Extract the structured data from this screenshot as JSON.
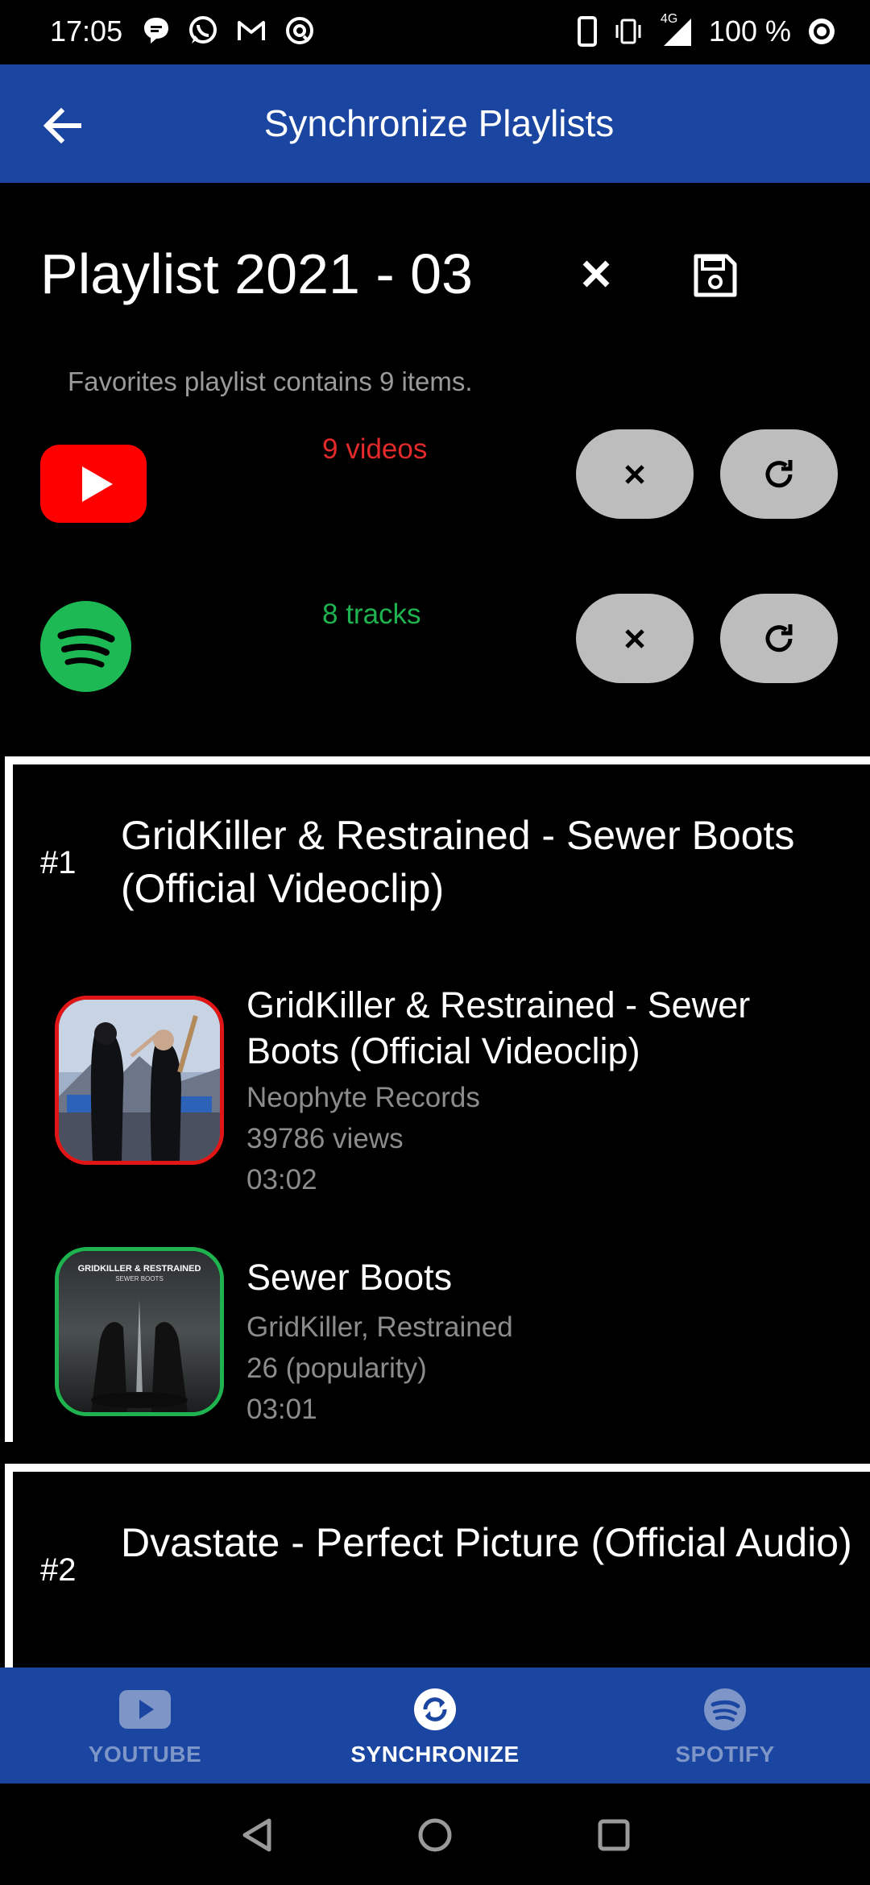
{
  "status_bar": {
    "time": "17:05",
    "network": "4G",
    "battery": "100 %",
    "left_icons": [
      "message-icon",
      "whatsapp-icon",
      "gmail-icon",
      "sync-icon"
    ],
    "right_icons": [
      "phone-icon",
      "vibrate-icon",
      "signal-icon",
      "target-icon"
    ]
  },
  "app_bar": {
    "title": "Synchronize Playlists",
    "back_icon": "arrow-back-icon"
  },
  "playlist": {
    "title": "Playlist 2021 - 03",
    "favorites_text": "Favorites playlist contains 9 items.",
    "youtube_count": "9 videos",
    "spotify_count": "8 tracks",
    "colors": {
      "youtube": "#ff0000",
      "spotify": "#1db954",
      "youtube_count_text": "#e32a2a",
      "spotify_count_text": "#1fb34f",
      "accent": "#1a45a0"
    }
  },
  "items": [
    {
      "number": "#1",
      "title": "GridKiller & Restrained - Sewer Boots (Official Videoclip)",
      "youtube": {
        "title": "GridKiller & Restrained - Sewer Boots (Official Videoclip)",
        "channel": "Neophyte Records",
        "views": "39786 views",
        "duration": "03:02"
      },
      "spotify": {
        "title": "Sewer Boots",
        "artists": "GridKiller, Restrained",
        "popularity": "26 (popularity)",
        "duration": "03:01",
        "cover_text_line1": "GRIDKILLER & RESTRAINED",
        "cover_text_line2": "SEWER BOOTS"
      }
    },
    {
      "number": "#2",
      "title": "Dvastate - Perfect Picture (Official Audio)"
    }
  ],
  "bottom_nav": {
    "items": [
      {
        "label": "YOUTUBE",
        "icon": "youtube-icon",
        "active": false
      },
      {
        "label": "SYNCHRONIZE",
        "icon": "synchronize-icon",
        "active": true
      },
      {
        "label": "SPOTIFY",
        "icon": "spotify-icon",
        "active": false
      }
    ]
  }
}
